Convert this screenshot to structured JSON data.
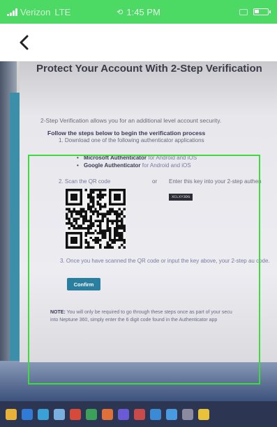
{
  "status_bar": {
    "carrier": "Verizon",
    "network": "LTE",
    "time": "1:45 PM"
  },
  "nav": {
    "back_icon": "chevron-left-icon"
  },
  "document": {
    "title": "Protect Your Account With 2-Step Verification",
    "intro": "2-Step Verification allows you for an additional level account security.",
    "follow": "Follow the steps below to begin the verification process",
    "step1": "1. Download one of the following authenticator applications",
    "apps": [
      {
        "name": "Microsoft Authenticator",
        "platform": "for Android and iOS"
      },
      {
        "name": "Google Authenticator",
        "platform": "for Android and iOS"
      }
    ],
    "step2": "2. Scan the QR code",
    "or": "or",
    "enter_key": "Enter this key into your 2-step authen",
    "secret_key": "XCLXY3DG",
    "step3": "3. Once you have scanned the QR code or input the key above, your 2-step au code.",
    "confirm_label": "Confirm",
    "note_label": "NOTE:",
    "note_text": "You will only be required to go through these steps once as part of your secu",
    "note_text_2": "into Neptune 360, simply enter the 6 digit code found in the Authenticator app"
  },
  "colors": {
    "status_bar": "#4cd964",
    "scan_frame": "#3ddc3d",
    "confirm_button": "#2a7fa0"
  },
  "taskbar_icons": [
    "files-icon",
    "mail-icon",
    "edge-icon",
    "store-icon",
    "chrome-icon",
    "excel-icon",
    "firefox-icon",
    "teams-icon",
    "chrome-icon",
    "edge-icon",
    "onedrive-icon",
    "settings-icon",
    "notes-icon"
  ]
}
